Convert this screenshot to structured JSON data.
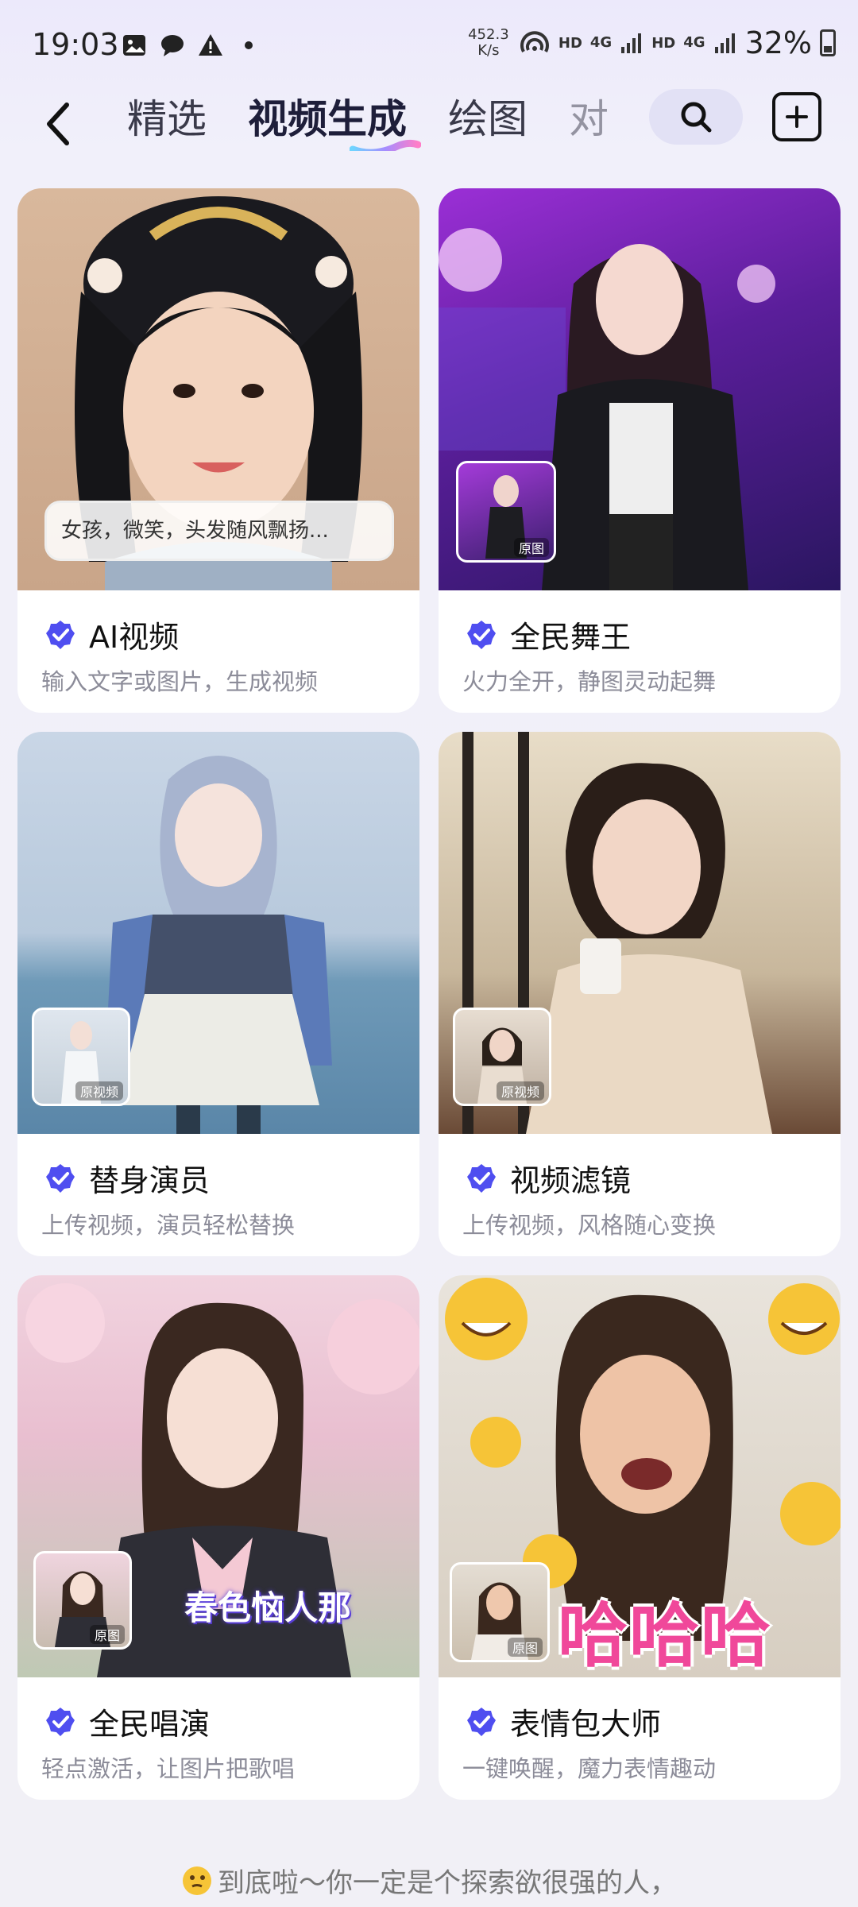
{
  "status": {
    "time": "19:03",
    "net_speed_value": "452.3",
    "net_speed_unit": "K/s",
    "hd1": "HD",
    "net1": "4G",
    "hd2": "HD",
    "net2": "4G",
    "battery": "32%"
  },
  "nav": {
    "tabs": [
      "精选",
      "视频生成",
      "绘图",
      "对"
    ],
    "active_tab": "视频生成"
  },
  "cards": [
    {
      "title": "AI视频",
      "subtitle": "输入文字或图片，生成视频",
      "prompt": "女孩，微笑，头发随风飘扬..."
    },
    {
      "title": "全民舞王",
      "subtitle": "火力全开，静图灵动起舞",
      "orig_label": "原图"
    },
    {
      "title": "替身演员",
      "subtitle": "上传视频，演员轻松替换",
      "orig_label": "原视频"
    },
    {
      "title": "视频滤镜",
      "subtitle": "上传视频，风格随心变换",
      "orig_label": "原视频"
    },
    {
      "title": "全民唱演",
      "subtitle": "轻点激活，让图片把歌唱",
      "orig_label": "原图",
      "overlay": "春色恼人那"
    },
    {
      "title": "表情包大师",
      "subtitle": "一键唤醒，魔力表情趣动",
      "orig_label": "原图",
      "overlay": "哈哈哈"
    }
  ],
  "footer": {
    "text": "到底啦～你一定是个探索欲很强的人，"
  },
  "colors": {
    "accent": "#4f4ef0",
    "background": "#f1f0f6"
  }
}
